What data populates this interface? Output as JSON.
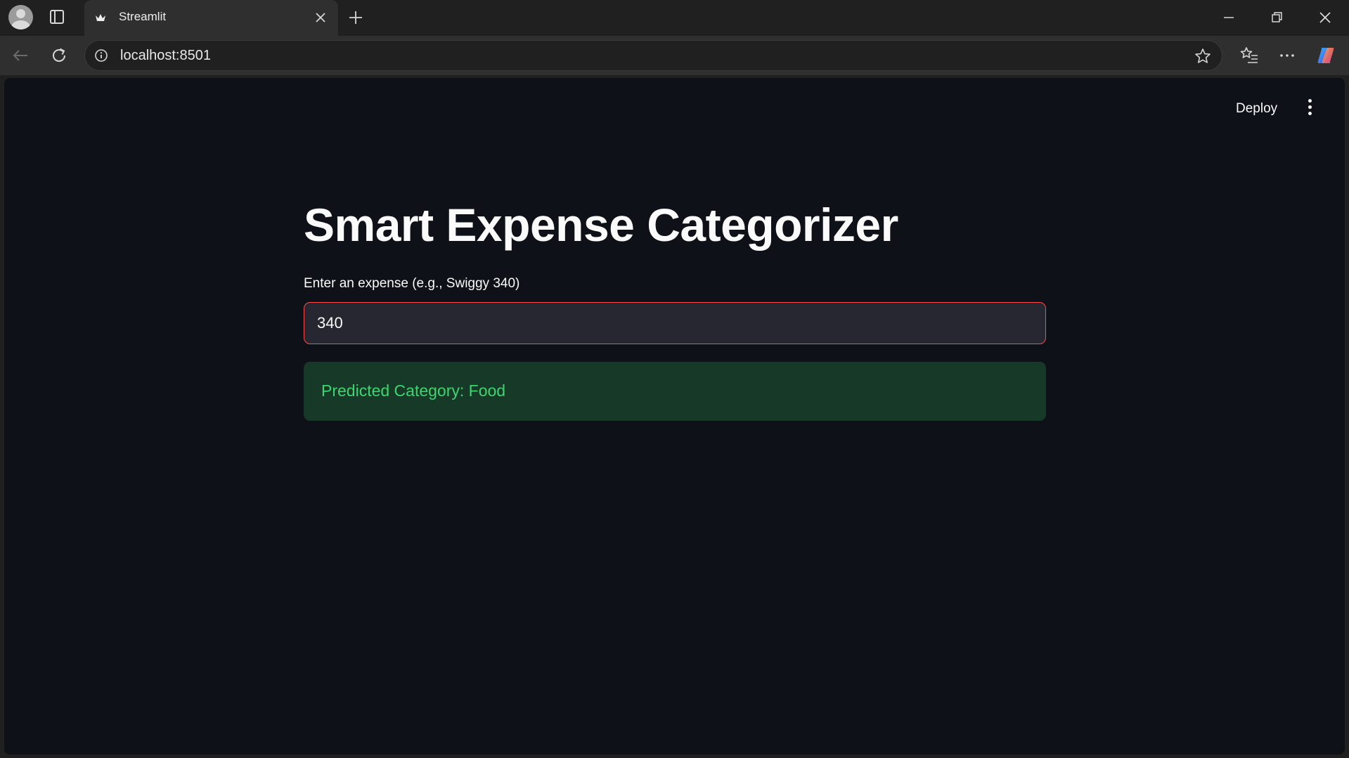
{
  "browser": {
    "tab": {
      "title": "Streamlit"
    },
    "address_bar": {
      "url": "localhost:8501"
    }
  },
  "app": {
    "header": {
      "deploy_label": "Deploy"
    },
    "title": "Smart Expense Categorizer",
    "expense_input": {
      "label": "Enter an expense (e.g., Swiggy 340)",
      "value": "340"
    },
    "result": {
      "message": "Predicted Category: Food",
      "status": "success"
    }
  },
  "colors": {
    "page_background": "#0e1117",
    "input_focus_border": "#ff4b4b",
    "success_background": "#173928",
    "success_text": "#3dd56d"
  }
}
